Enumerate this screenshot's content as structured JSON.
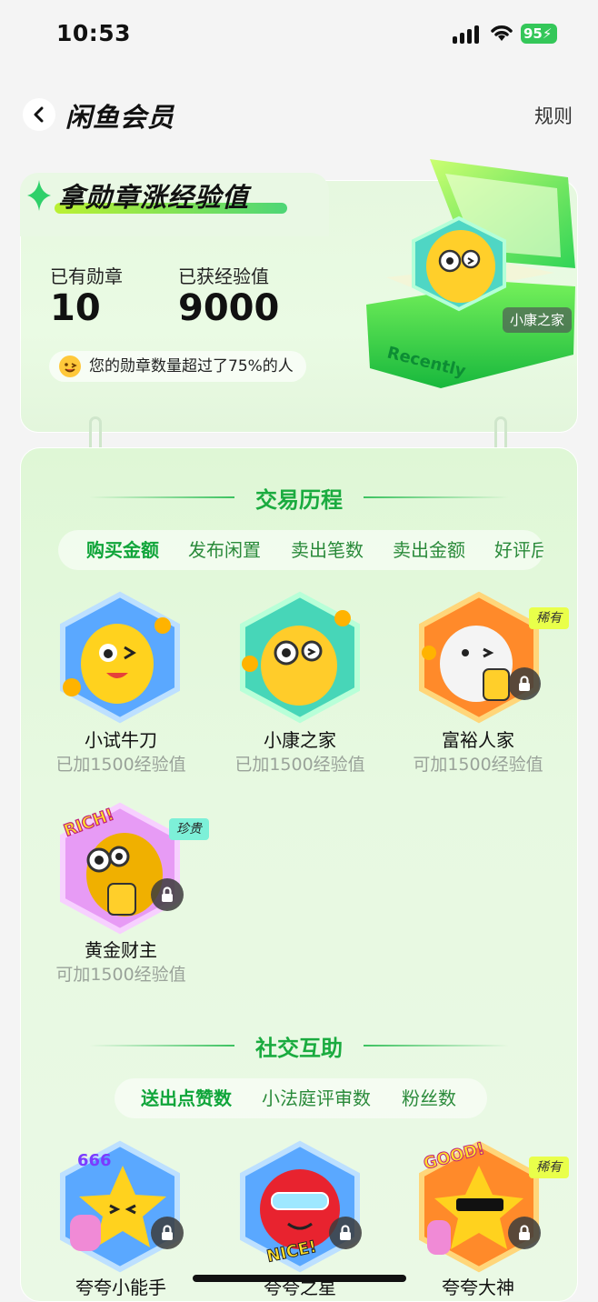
{
  "status_bar": {
    "time": "10:53",
    "battery": "95"
  },
  "header": {
    "title": "闲鱼会员",
    "rules_label": "规则"
  },
  "hero": {
    "title": "拿勋章涨经验值",
    "medals_label": "已有勋章",
    "medals_value": "10",
    "exp_label": "已获经验值",
    "exp_value": "9000",
    "compare_text": "您的勋章数量超过了75%的人",
    "showcase_name": "小康之家",
    "box_label": "Recently"
  },
  "sections": [
    {
      "title": "交易历程",
      "tabs": [
        "购买金额",
        "发布闲置",
        "卖出笔数",
        "卖出金额",
        "好评后"
      ],
      "active_tab": 0,
      "medals": [
        {
          "name": "小试牛刀",
          "status": "已加1500经验值",
          "locked": false,
          "rarity": ""
        },
        {
          "name": "小康之家",
          "status": "已加1500经验值",
          "locked": false,
          "rarity": ""
        },
        {
          "name": "富裕人家",
          "status": "可加1500经验值",
          "locked": true,
          "rarity": "稀有"
        },
        {
          "name": "黄金财主",
          "status": "可加1500经验值",
          "locked": true,
          "rarity": "珍贵",
          "badge_text": "RICH!"
        }
      ]
    },
    {
      "title": "社交互助",
      "tabs": [
        "送出点赞数",
        "小法庭评审数",
        "粉丝数"
      ],
      "active_tab": 0,
      "medals": [
        {
          "name": "夸夸小能手",
          "locked": true,
          "rarity": "",
          "badge_text": "666"
        },
        {
          "name": "夸夸之星",
          "locked": true,
          "rarity": "",
          "badge_text": "NICE!"
        },
        {
          "name": "夸夸大神",
          "locked": true,
          "rarity": "稀有",
          "badge_text": "GOOD!"
        }
      ]
    }
  ],
  "colors": {
    "accent_green": "#1aab3f",
    "rare_tag": "#e9ff4a",
    "precious_tag": "#7df0d8"
  }
}
